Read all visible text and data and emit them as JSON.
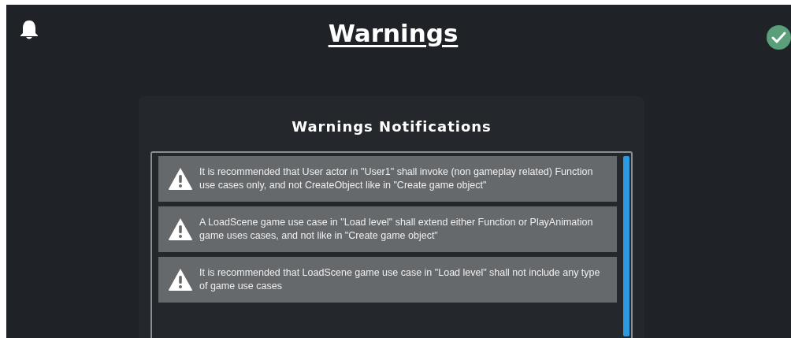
{
  "header": {
    "title": "Warnings"
  },
  "panel": {
    "title": "Warnings Notifications",
    "warnings": [
      {
        "text": "It is recommended that User actor in \"User1\" shall invoke (non gameplay related) Function use cases only, and not CreateObject like in \"Create game object\""
      },
      {
        "text": "A LoadScene game use case in \"Load level\" shall extend either Function or PlayAnimation game uses cases, and not like in \"Create game object\""
      },
      {
        "text": "It is recommended that LoadScene game use case in \"Load level\" shall not include any type of game use cases"
      }
    ]
  }
}
